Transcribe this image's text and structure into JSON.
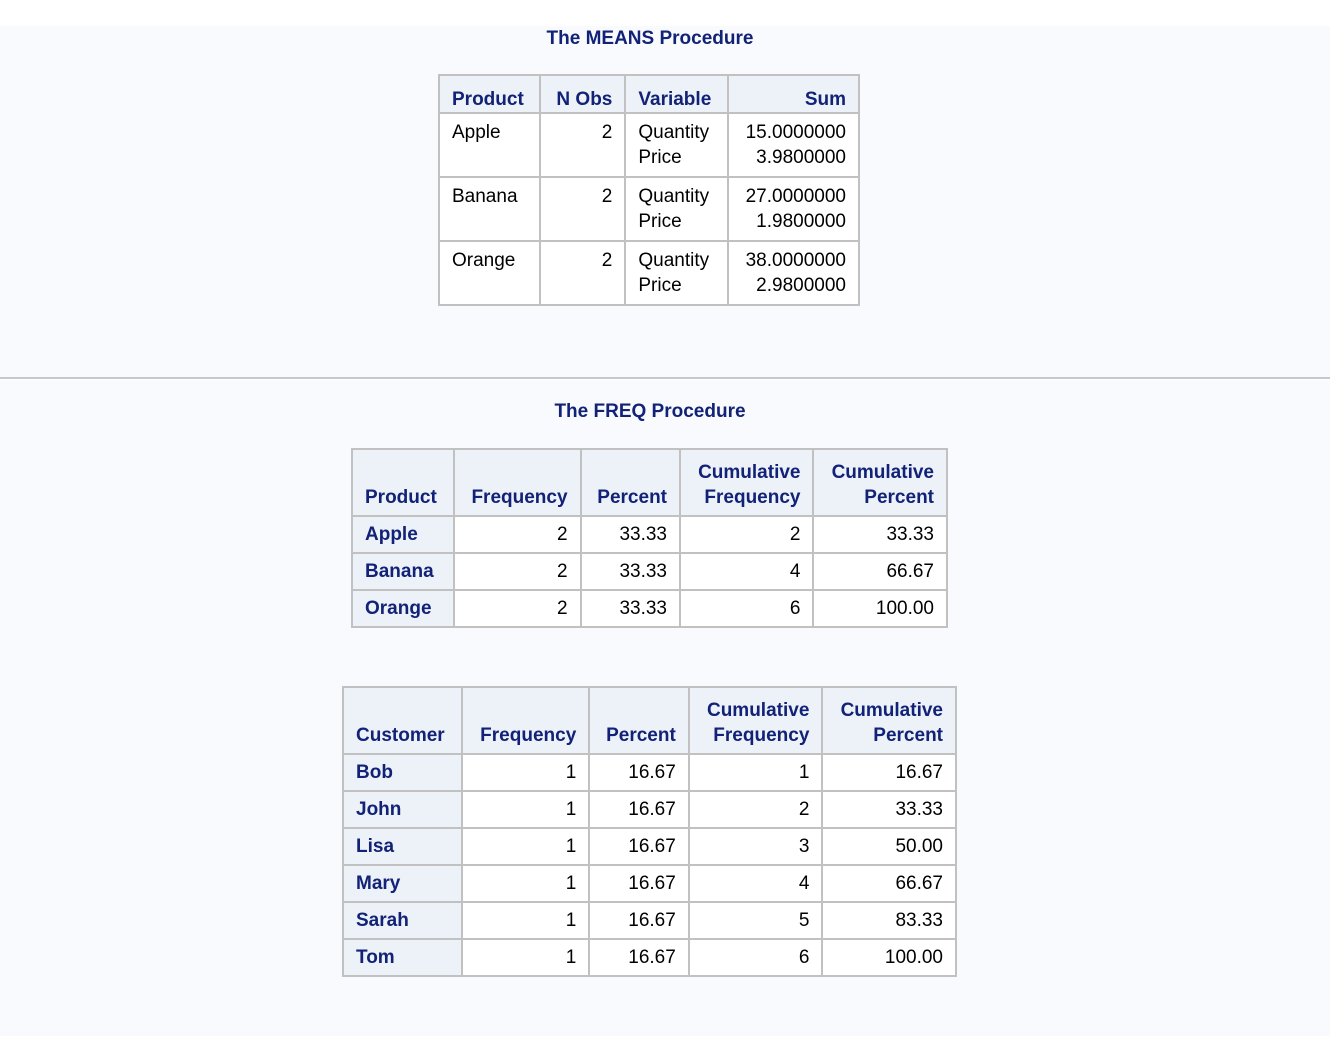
{
  "means": {
    "title": "The MEANS Procedure",
    "headers": {
      "product": "Product",
      "nobs": "N Obs",
      "variable": "Variable",
      "sum": "Sum"
    },
    "rows": [
      {
        "product": "Apple",
        "nobs": "2",
        "variables": [
          "Quantity",
          "Price"
        ],
        "sums": [
          "15.0000000",
          "3.9800000"
        ]
      },
      {
        "product": "Banana",
        "nobs": "2",
        "variables": [
          "Quantity",
          "Price"
        ],
        "sums": [
          "27.0000000",
          "1.9800000"
        ]
      },
      {
        "product": "Orange",
        "nobs": "2",
        "variables": [
          "Quantity",
          "Price"
        ],
        "sums": [
          "38.0000000",
          "2.9800000"
        ]
      }
    ]
  },
  "freq": {
    "title": "The FREQ Procedure",
    "common_headers": {
      "frequency": "Frequency",
      "percent": "Percent",
      "cum_freq_1": "Cumulative",
      "cum_freq_2": "Frequency",
      "cum_pct_1": "Cumulative",
      "cum_pct_2": "Percent"
    },
    "product_table": {
      "row_header": "Product",
      "rows": [
        {
          "label": "Apple",
          "frequency": "2",
          "percent": "33.33",
          "cum_freq": "2",
          "cum_pct": "33.33"
        },
        {
          "label": "Banana",
          "frequency": "2",
          "percent": "33.33",
          "cum_freq": "4",
          "cum_pct": "66.67"
        },
        {
          "label": "Orange",
          "frequency": "2",
          "percent": "33.33",
          "cum_freq": "6",
          "cum_pct": "100.00"
        }
      ]
    },
    "customer_table": {
      "row_header": "Customer",
      "rows": [
        {
          "label": "Bob",
          "frequency": "1",
          "percent": "16.67",
          "cum_freq": "1",
          "cum_pct": "16.67"
        },
        {
          "label": "John",
          "frequency": "1",
          "percent": "16.67",
          "cum_freq": "2",
          "cum_pct": "33.33"
        },
        {
          "label": "Lisa",
          "frequency": "1",
          "percent": "16.67",
          "cum_freq": "3",
          "cum_pct": "50.00"
        },
        {
          "label": "Mary",
          "frequency": "1",
          "percent": "16.67",
          "cum_freq": "4",
          "cum_pct": "66.67"
        },
        {
          "label": "Sarah",
          "frequency": "1",
          "percent": "16.67",
          "cum_freq": "5",
          "cum_pct": "83.33"
        },
        {
          "label": "Tom",
          "frequency": "1",
          "percent": "16.67",
          "cum_freq": "6",
          "cum_pct": "100.00"
        }
      ]
    }
  }
}
